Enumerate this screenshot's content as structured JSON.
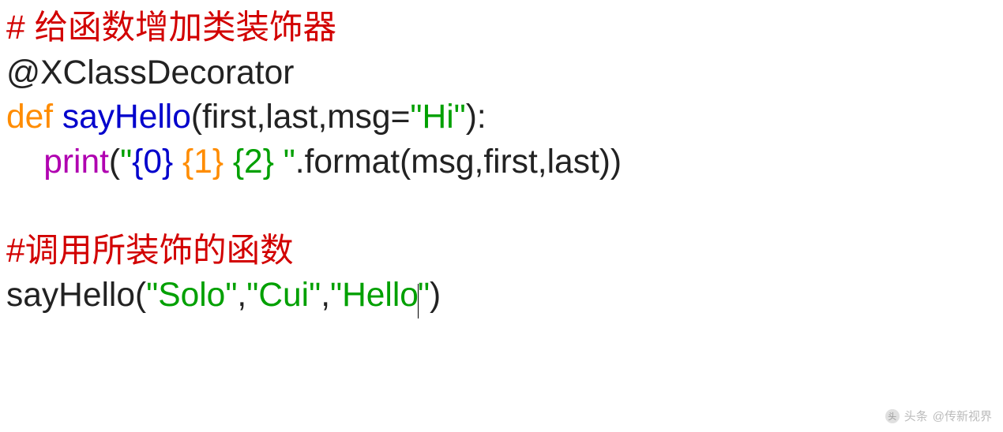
{
  "code": {
    "line1": {
      "comment": "# 给函数增加类装饰器"
    },
    "line2": {
      "at": "@",
      "decorator": "XClassDecorator"
    },
    "line3": {
      "def": "def ",
      "func": "sayHello",
      "open": "(",
      "p1": "first",
      "c1": ",",
      "p2": "last",
      "c2": ",",
      "p3": "msg",
      "eq": "=",
      "default_q1": "\"",
      "default": "Hi",
      "default_q2": "\"",
      "close": "):"
    },
    "line4": {
      "indent": "    ",
      "print": "print",
      "open": "(",
      "q1": "\"",
      "fmt0": "{0}",
      "sp1": " ",
      "fmt1": "{1}",
      "sp2": " ",
      "fmt2": "{2}",
      "sp3": " ",
      "q2": "\"",
      "dot": ".",
      "format": "format",
      "open2": "(",
      "a1": "msg",
      "c1": ",",
      "a2": "first",
      "c2": ",",
      "a3": "last",
      "close2": "))"
    },
    "line6": {
      "comment": "#调用所装饰的函数"
    },
    "line7": {
      "call": "sayHello",
      "open": "(",
      "q1a": "\"",
      "s1": "Solo",
      "q1b": "\"",
      "c1": ",",
      "q2a": "\"",
      "s2": "Cui",
      "q2b": "\"",
      "c2": ",",
      "q3a": "\"",
      "s3": "Hello",
      "q3b": "\"",
      "close": ")"
    }
  },
  "watermark": {
    "label": "头条",
    "author": "@传新视界"
  }
}
